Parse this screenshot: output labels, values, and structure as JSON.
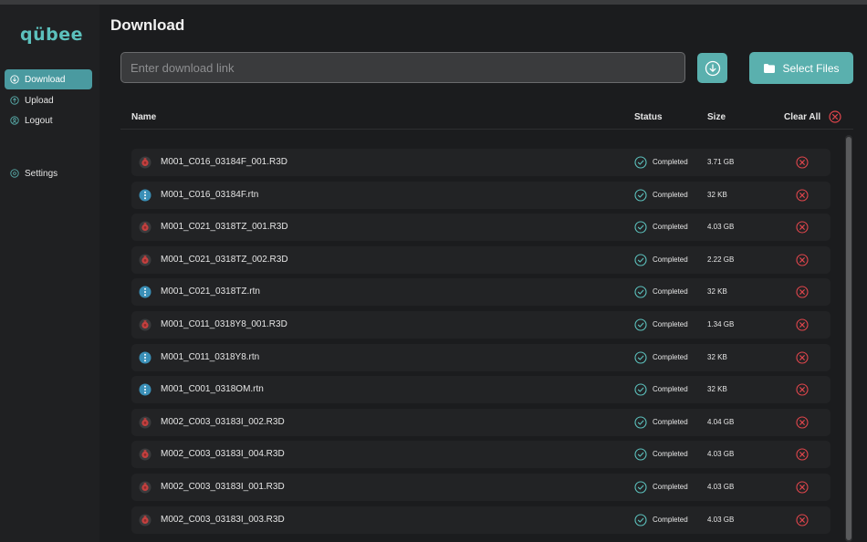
{
  "app": {
    "logo": "qübee"
  },
  "sidebar": {
    "items": [
      {
        "label": "Download",
        "icon": "download-circle-icon",
        "active": true
      },
      {
        "label": "Upload",
        "icon": "upload-circle-icon",
        "active": false
      },
      {
        "label": "Logout",
        "icon": "user-circle-icon",
        "active": false
      },
      {
        "label": "Settings",
        "icon": "gear-icon",
        "active": false
      }
    ]
  },
  "header": {
    "title": "Download"
  },
  "download_bar": {
    "placeholder": "Enter download link",
    "value": "",
    "select_files_label": "Select Files"
  },
  "table": {
    "columns": {
      "name": "Name",
      "status": "Status",
      "size": "Size",
      "clear_all": "Clear All"
    },
    "rows": [
      {
        "name": "M001_C016_03184F_001.R3D",
        "type": "r3d",
        "status": "Completed",
        "size": "3.71 GB"
      },
      {
        "name": "M001_C016_03184F.rtn",
        "type": "rtn",
        "status": "Completed",
        "size": "32 KB"
      },
      {
        "name": "M001_C021_0318TZ_001.R3D",
        "type": "r3d",
        "status": "Completed",
        "size": "4.03 GB"
      },
      {
        "name": "M001_C021_0318TZ_002.R3D",
        "type": "r3d",
        "status": "Completed",
        "size": "2.22 GB"
      },
      {
        "name": "M001_C021_0318TZ.rtn",
        "type": "rtn",
        "status": "Completed",
        "size": "32 KB"
      },
      {
        "name": "M001_C011_0318Y8_001.R3D",
        "type": "r3d",
        "status": "Completed",
        "size": "1.34 GB"
      },
      {
        "name": "M001_C011_0318Y8.rtn",
        "type": "rtn",
        "status": "Completed",
        "size": "32 KB"
      },
      {
        "name": "M001_C001_0318OM.rtn",
        "type": "rtn",
        "status": "Completed",
        "size": "32 KB"
      },
      {
        "name": "M002_C003_03183I_002.R3D",
        "type": "r3d",
        "status": "Completed",
        "size": "4.04 GB"
      },
      {
        "name": "M002_C003_03183I_004.R3D",
        "type": "r3d",
        "status": "Completed",
        "size": "4.03 GB"
      },
      {
        "name": "M002_C003_03183I_001.R3D",
        "type": "r3d",
        "status": "Completed",
        "size": "4.03 GB"
      },
      {
        "name": "M002_C003_03183I_003.R3D",
        "type": "r3d",
        "status": "Completed",
        "size": "4.03 GB"
      }
    ]
  },
  "colors": {
    "accent": "#5ab0ae",
    "success": "#5cc1bd",
    "danger": "#e0464c",
    "rtn_icon": "#3a8fb7",
    "r3d_icon": "#c4403f"
  }
}
